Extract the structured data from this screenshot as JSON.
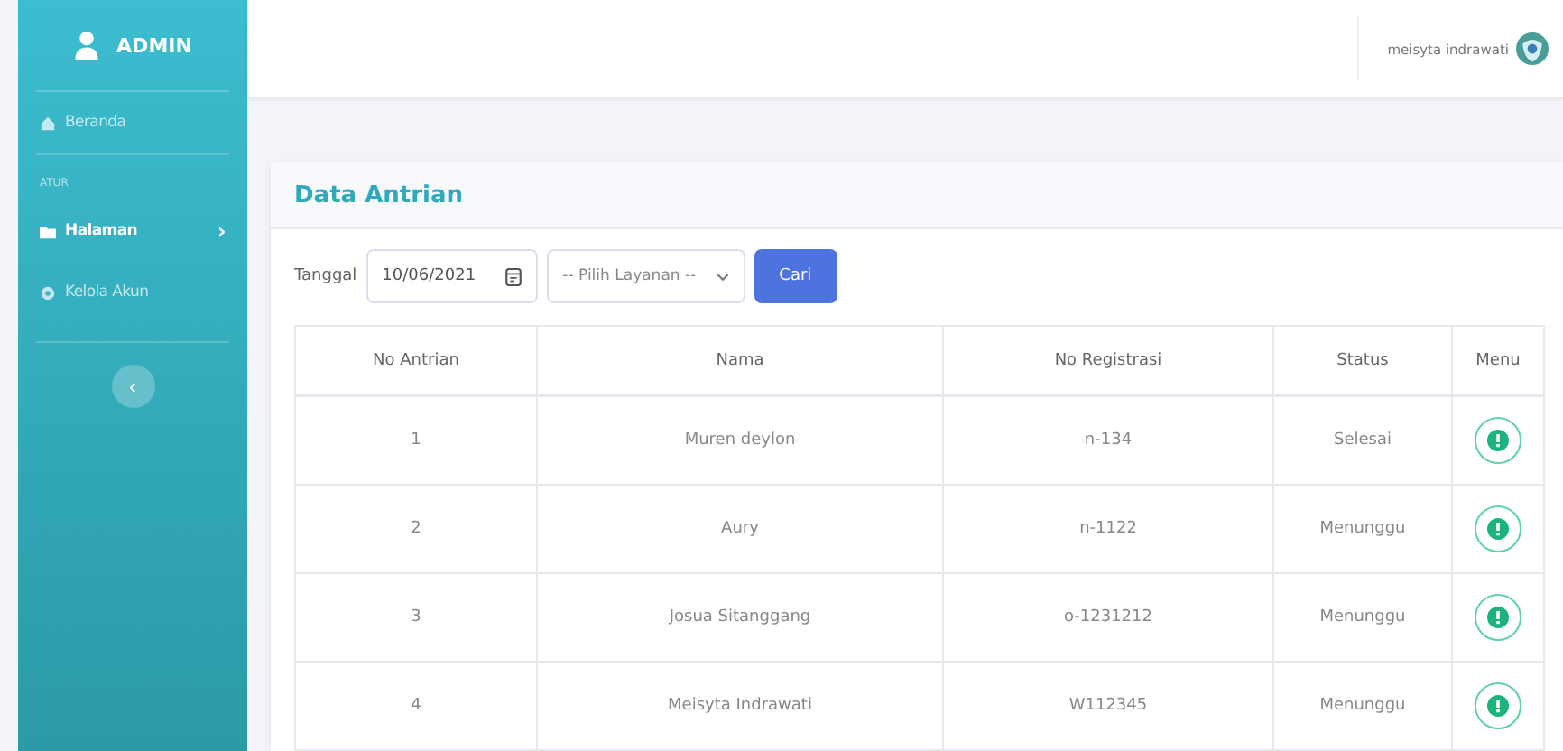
{
  "sidebar": {
    "brand": "ADMIN",
    "items": [
      {
        "kind": "link",
        "label": "Beranda",
        "selected": false
      },
      {
        "kind": "heading",
        "label": "ATUR"
      },
      {
        "kind": "link",
        "label": "Halaman",
        "selected": true,
        "chevron": "›"
      },
      {
        "kind": "link",
        "label": "Kelola Akun",
        "selected": false
      }
    ],
    "toggle": "‹"
  },
  "topbar": {
    "user": "meisyta indrawati"
  },
  "card": {
    "title": "Data Antrian",
    "filter": {
      "label": "Tanggal",
      "date": "10/06/2021",
      "select": "-- Pilih Layanan --",
      "button": "Cari"
    },
    "table": {
      "columns": [
        "No Antrian",
        "Nama",
        "No Registrasi",
        "Status",
        "Menu"
      ],
      "rows": [
        [
          "1",
          "Muren deylon",
          "n-134",
          "Selesai"
        ],
        [
          "2",
          "Aury",
          "n-1122",
          "Menunggu"
        ],
        [
          "3",
          "Josua Sitanggang",
          "o-1231212",
          "Menunggu"
        ],
        [
          "4",
          "Meisyta Indrawati",
          "W112345",
          "Menunggu"
        ]
      ]
    }
  }
}
